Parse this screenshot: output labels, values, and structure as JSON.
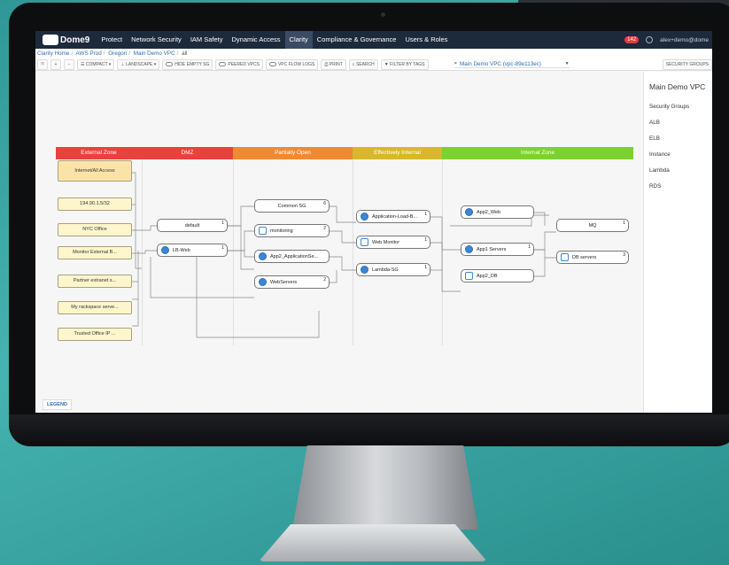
{
  "colors": {
    "background": "#3aa6a4",
    "nav_bg": "#1c2a3c",
    "nav_active": "#3a4b63",
    "link": "#2b6cb0",
    "zone_external": "#e8423c",
    "zone_dmz": "#e8423c",
    "zone_partial": "#ef8a32",
    "zone_effective": "#d8b72d",
    "zone_internal": "#7bd12e",
    "source_fill": "#fdf6cc"
  },
  "nav": {
    "logo": "Dome9",
    "items": [
      "Protect",
      "Network Security",
      "IAM Safety",
      "Dynamic Access",
      "Clarity",
      "Compliance & Governance",
      "Users & Roles"
    ],
    "active_index": 4,
    "notifications": "142",
    "user": "alex+demo@dome"
  },
  "breadcrumb": [
    "Clarity Home",
    "AWS Prod",
    "Oregon",
    "Main Demo VPC",
    "all"
  ],
  "toolbar": {
    "compact": "COMPACT",
    "landscape": "LANDSCAPE",
    "hide_empty_sg": "HIDE EMPTY SG",
    "peered_vpcs": "PEERED VPCS",
    "vpc_flow_logs": "VPC FLOW LOGS",
    "print": "PRINT",
    "search": "SEARCH",
    "filter_by_tags": "FILTER BY TAGS",
    "vpc_selected": "Main Demo VPC (vpc-89e113ec)",
    "security_groups": "SECURITY GROUPS"
  },
  "side_panel": {
    "title": "Main Demo VPC",
    "items": [
      "Security Groups",
      "ALB",
      "ELB",
      "Instance",
      "Lambda",
      "RDS"
    ]
  },
  "legend": "LEGEND",
  "zones": [
    "External Zone",
    "DMZ",
    "Partially Open",
    "Effectively Internal",
    "Internal Zone"
  ],
  "sources": [
    "Internet/All Access",
    "194.90.1.5/32",
    "NYC Office",
    "Monitor External B...",
    "Partner extranet s...",
    "My rackspace serve...",
    "Trusted Office IP ..."
  ],
  "dmz_nodes": [
    {
      "label": "default",
      "count": "1"
    },
    {
      "label": "LB-Web",
      "count": "1"
    }
  ],
  "partial_nodes": [
    {
      "label": "Common SG",
      "count": "6"
    },
    {
      "label": "monitoring",
      "count": "2"
    },
    {
      "label": "App2_ApplicationSe...",
      "count": ""
    },
    {
      "label": "WebServers",
      "count": "2"
    }
  ],
  "effective_nodes": [
    {
      "label": "Application-Load-B...",
      "count": "1"
    },
    {
      "label": "Web Monitor",
      "count": "1"
    },
    {
      "label": "Lambda-SG",
      "count": "1"
    }
  ],
  "internal_nodes": [
    {
      "label": "App2_Web",
      "count": ""
    },
    {
      "label": "App1 Servers",
      "count": "1"
    },
    {
      "label": "App2_DB",
      "count": ""
    },
    {
      "label": "MQ",
      "count": "1"
    },
    {
      "label": "DB servers",
      "count": "3"
    }
  ]
}
